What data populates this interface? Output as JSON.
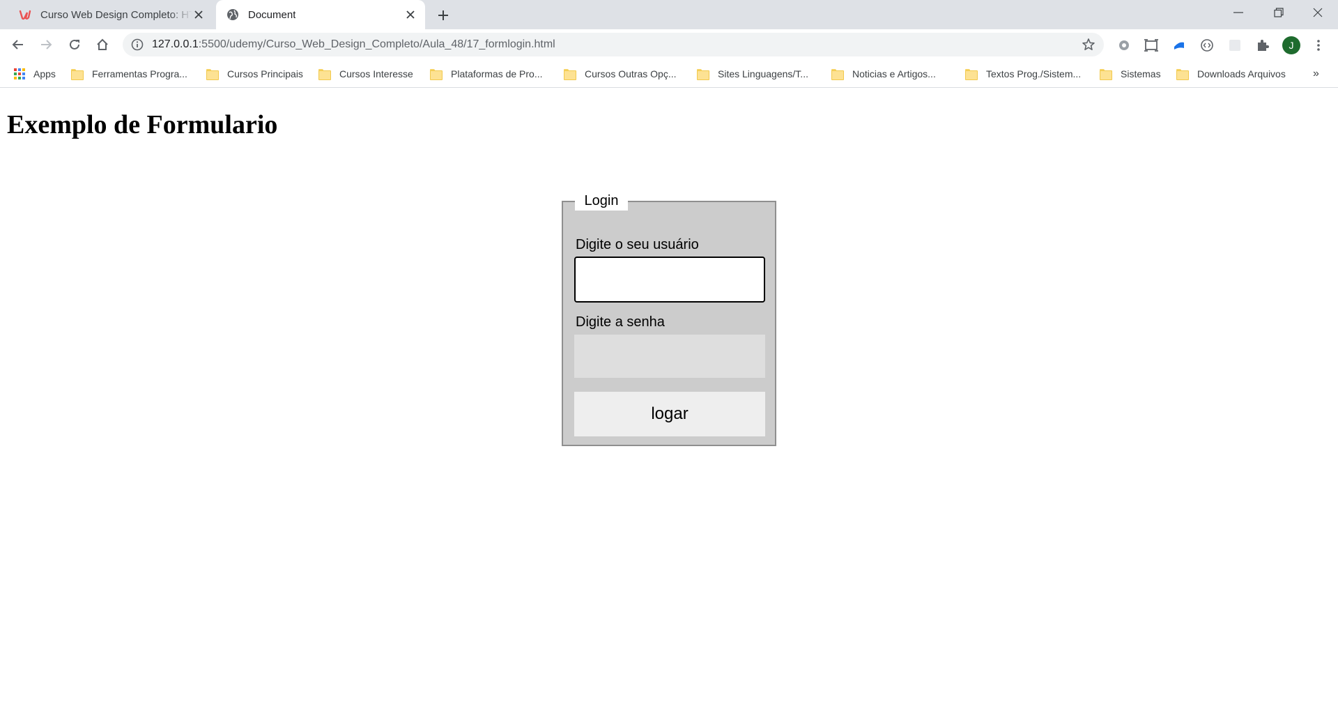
{
  "browser": {
    "tabs": [
      {
        "title": "Curso Web Design Completo: HT",
        "favicon": "udemy-logo-icon",
        "active": false
      },
      {
        "title": "Document",
        "favicon": "globe-icon",
        "active": true
      }
    ],
    "address_bar": {
      "host": "127.0.0.1",
      "path": ":5500/udemy/Curso_Web_Design_Completo/Aula_48/17_formlogin.html"
    },
    "profile_initial": "J",
    "colors": {
      "tabstrip": "#dee1e6",
      "avatar": "#1e6b2e"
    }
  },
  "bookmarks": {
    "apps_label": "Apps",
    "items": [
      "Ferramentas Progra...",
      "Cursos Principais",
      "Cursos Interesse",
      "Plataformas de Pro...",
      "Cursos Outras Opç...",
      "Sites Linguagens/T...",
      "Noticias e Artigos...",
      "Textos Prog./Sistem...",
      "Sistemas",
      "Downloads Arquivos"
    ],
    "overflow": "»"
  },
  "page": {
    "heading": "Exemplo de Formulario",
    "form": {
      "legend": "Login",
      "user_label": "Digite o seu usuário",
      "user_value": "",
      "password_label": "Digite a senha",
      "password_value": "",
      "submit_label": "logar"
    },
    "colors": {
      "fieldset_bg": "#cccccc",
      "password_bg": "#dedede",
      "button_bg": "#eeeeee"
    }
  }
}
